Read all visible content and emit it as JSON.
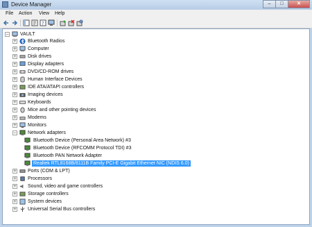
{
  "window": {
    "title": "Device Manager",
    "minimize": "–",
    "maximize": "□",
    "close": "✕"
  },
  "menu": [
    "File",
    "Action",
    "View",
    "Help"
  ],
  "toolbar": [
    "back-icon",
    "forward-icon",
    "show-hide-tree-icon",
    "properties-icon",
    "help-icon",
    "monitor-icon",
    "update-driver-icon",
    "uninstall-icon",
    "scan-hardware-icon"
  ],
  "tree": {
    "root": "VAULT",
    "nodes": [
      {
        "label": "Bluetooth Radios",
        "icon": "bluetooth-icon"
      },
      {
        "label": "Computer",
        "icon": "computer-icon"
      },
      {
        "label": "Disk drives",
        "icon": "disk-drive-icon"
      },
      {
        "label": "Display adapters",
        "icon": "display-adapter-icon"
      },
      {
        "label": "DVD/CD-ROM drives",
        "icon": "dvd-drive-icon"
      },
      {
        "label": "Human Interface Devices",
        "icon": "hid-icon"
      },
      {
        "label": "IDE ATA/ATAPI controllers",
        "icon": "ide-controller-icon"
      },
      {
        "label": "Imaging devices",
        "icon": "camera-icon"
      },
      {
        "label": "Keyboards",
        "icon": "keyboard-icon"
      },
      {
        "label": "Mice and other pointing devices",
        "icon": "mouse-icon"
      },
      {
        "label": "Modems",
        "icon": "modem-icon"
      },
      {
        "label": "Monitors",
        "icon": "monitor-icon"
      },
      {
        "label": "Network adapters",
        "icon": "network-adapter-icon",
        "expanded": true,
        "children": [
          {
            "label": "Bluetooth Device (Personal Area Network) #3"
          },
          {
            "label": "Bluetooth Device (RFCOMM Protocol TDI) #3"
          },
          {
            "label": "Bluetooth PAN Network Adapter"
          },
          {
            "label": "Realtek RTL8168B/8111B Family PCI-E Gigabit Ethernet NIC (NDIS 6.0)",
            "selected": true
          }
        ]
      },
      {
        "label": "Ports (COM & LPT)",
        "icon": "port-icon"
      },
      {
        "label": "Processors",
        "icon": "processor-icon"
      },
      {
        "label": "Sound, video and game controllers",
        "icon": "sound-icon"
      },
      {
        "label": "Storage controllers",
        "icon": "storage-controller-icon"
      },
      {
        "label": "System devices",
        "icon": "system-device-icon"
      },
      {
        "label": "Universal Serial Bus controllers",
        "icon": "usb-icon"
      }
    ]
  },
  "colors": {
    "selection": "#3399ff",
    "window_frame": "#bcd3ea"
  }
}
